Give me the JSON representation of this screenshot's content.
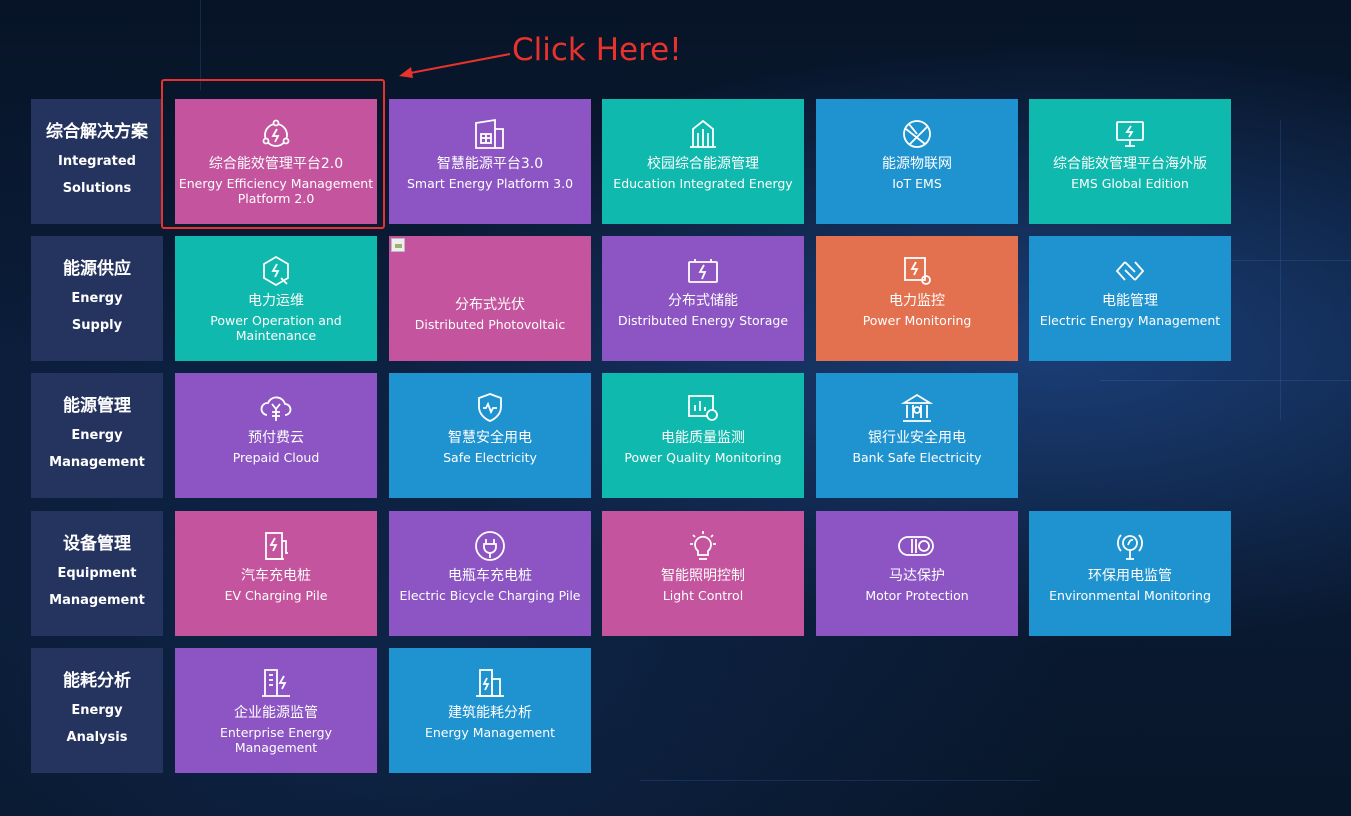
{
  "annotation": {
    "text": "Click Here!",
    "color": "#e8322c"
  },
  "categories": [
    {
      "zh": "综合解决方案",
      "en1": "Integrated",
      "en2": "Solutions"
    },
    {
      "zh": "能源供应",
      "en1": "Energy",
      "en2": "Supply"
    },
    {
      "zh": "能源管理",
      "en1": "Energy",
      "en2": "Management"
    },
    {
      "zh": "设备管理",
      "en1": "Equipment",
      "en2": "Management"
    },
    {
      "zh": "能耗分析",
      "en1": "Energy",
      "en2": "Analysis"
    }
  ],
  "tiles": {
    "r0": [
      {
        "zh": "综合能效管理平台2.0",
        "en": "Energy Efficiency Management Platform 2.0",
        "icon": "energy-circle-icon",
        "color": "#c4549e"
      },
      {
        "zh": "智慧能源平台3.0",
        "en": "Smart Energy Platform 3.0",
        "icon": "factory-icon",
        "color": "#8c55c3"
      },
      {
        "zh": "校园综合能源管理",
        "en": "Education Integrated Energy",
        "icon": "campus-building-icon",
        "color": "#0fb9ad"
      },
      {
        "zh": "能源物联网",
        "en": "IoT EMS",
        "icon": "iot-network-icon",
        "color": "#1f93d0"
      },
      {
        "zh": "综合能效管理平台海外版",
        "en": "EMS Global Edition",
        "icon": "monitor-energy-icon",
        "color": "#0fb9ad"
      }
    ],
    "r1": [
      {
        "zh": "电力运维",
        "en": "Power Operation and Maintenance",
        "icon": "maintenance-wrench-icon",
        "color": "#0fb9ad"
      },
      {
        "zh": "分布式光伏",
        "en": "Distributed Photovoltaic",
        "icon": "broken-image-icon",
        "color": "#c4549e"
      },
      {
        "zh": "分布式储能",
        "en": "Distributed Energy Storage",
        "icon": "battery-storage-icon",
        "color": "#8c55c3"
      },
      {
        "zh": "电力监控",
        "en": "Power Monitoring",
        "icon": "power-monitor-icon",
        "color": "#e37150"
      },
      {
        "zh": "电能管理",
        "en": "Electric Energy Management",
        "icon": "electric-management-icon",
        "color": "#1f93d0"
      }
    ],
    "r2": [
      {
        "zh": "预付费云",
        "en": "Prepaid Cloud",
        "icon": "prepaid-cloud-icon",
        "color": "#8c55c3"
      },
      {
        "zh": "智慧安全用电",
        "en": "Safe Electricity",
        "icon": "safety-shield-icon",
        "color": "#1f93d0"
      },
      {
        "zh": "电能质量监测",
        "en": "Power Quality Monitoring",
        "icon": "quality-chart-icon",
        "color": "#0fb9ad"
      },
      {
        "zh": "银行业安全用电",
        "en": "Bank Safe Electricity",
        "icon": "bank-icon",
        "color": "#1f93d0"
      }
    ],
    "r3": [
      {
        "zh": "汽车充电桩",
        "en": "EV Charging Pile",
        "icon": "ev-charger-icon",
        "color": "#c4549e"
      },
      {
        "zh": "电瓶车充电桩",
        "en": "Electric Bicycle Charging Pile",
        "icon": "plug-icon",
        "color": "#8c55c3"
      },
      {
        "zh": "智能照明控制",
        "en": "Light Control",
        "icon": "light-bulb-icon",
        "color": "#c4549e"
      },
      {
        "zh": "马达保护",
        "en": "Motor Protection",
        "icon": "motor-icon",
        "color": "#8c55c3"
      },
      {
        "zh": "环保用电监管",
        "en": "Environmental Monitoring",
        "icon": "eco-monitor-icon",
        "color": "#1f93d0"
      }
    ],
    "r4": [
      {
        "zh": "企业能源监管",
        "en": "Enterprise Energy Management",
        "icon": "enterprise-building-icon",
        "color": "#8c55c3"
      },
      {
        "zh": "建筑能耗分析",
        "en": "Energy Management",
        "icon": "building-energy-icon",
        "color": "#1f93d0"
      }
    ]
  }
}
